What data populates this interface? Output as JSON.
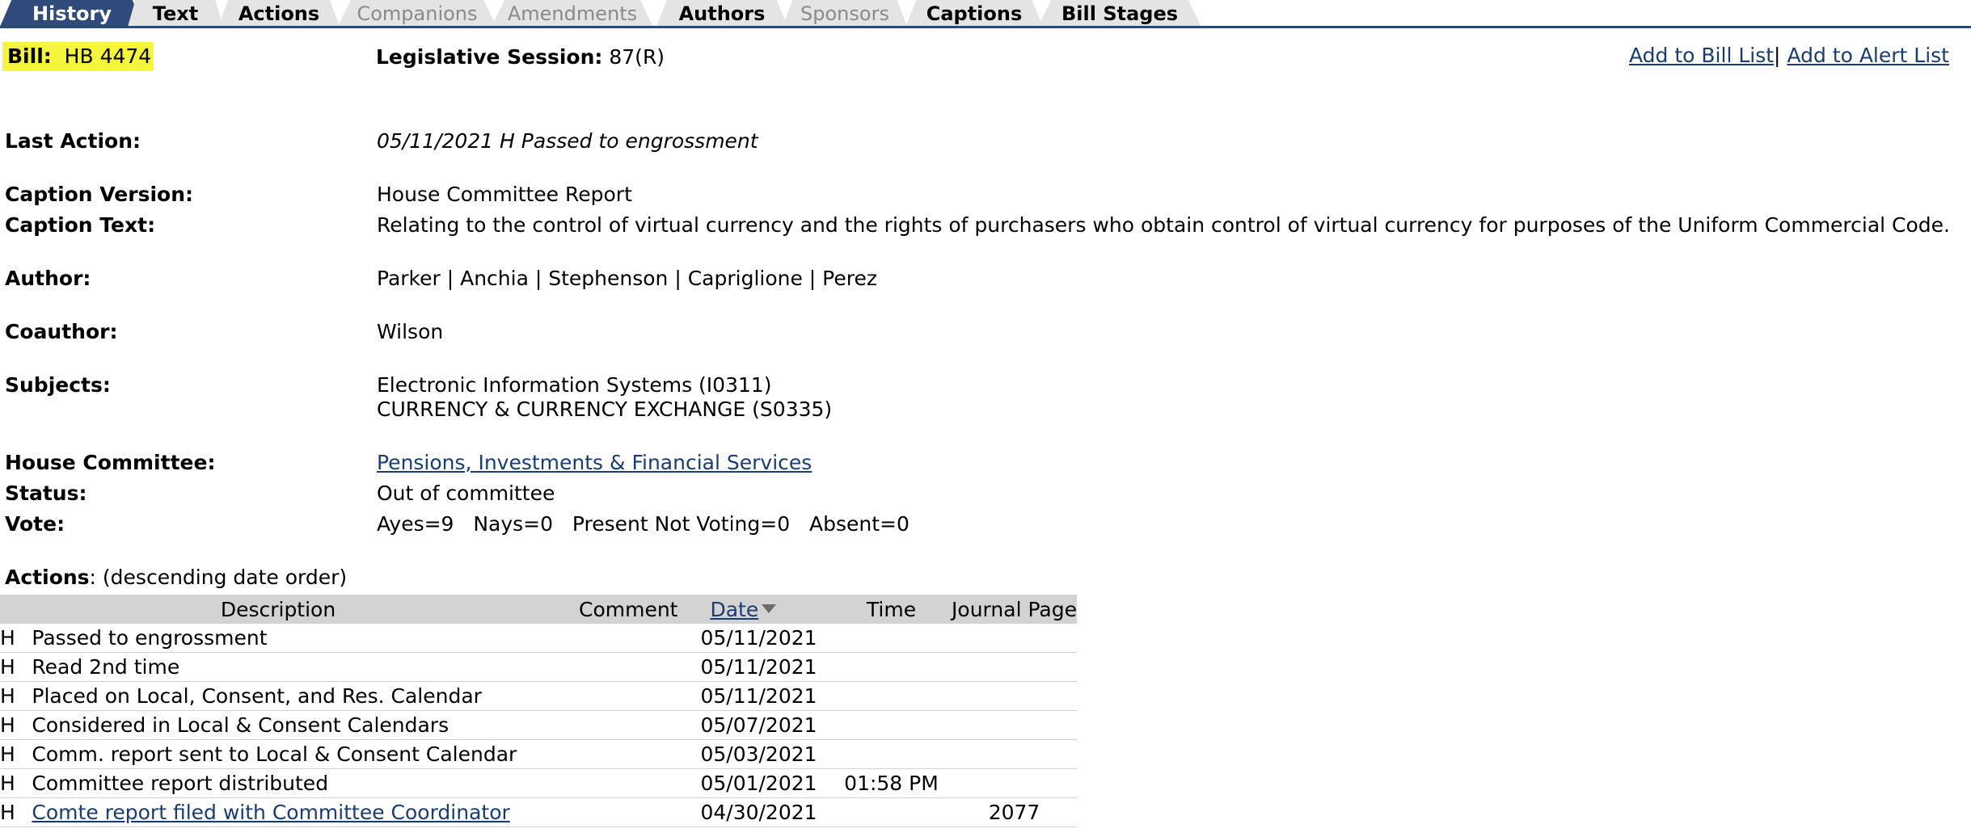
{
  "tabs": [
    {
      "label": "History",
      "state": "active"
    },
    {
      "label": "Text",
      "state": "on"
    },
    {
      "label": "Actions",
      "state": "on"
    },
    {
      "label": "Companions",
      "state": "off"
    },
    {
      "label": "Amendments",
      "state": "off"
    },
    {
      "label": "Authors",
      "state": "on"
    },
    {
      "label": "Sponsors",
      "state": "off"
    },
    {
      "label": "Captions",
      "state": "on"
    },
    {
      "label": "Bill Stages",
      "state": "on"
    }
  ],
  "bill": {
    "label": "Bill:",
    "value": "HB 4474"
  },
  "session": {
    "label": "Legislative Session:",
    "value": "87(R)"
  },
  "links": {
    "add_bill_list": "Add to Bill List",
    "separator": "|",
    "add_alert_list": "Add to Alert List"
  },
  "info": {
    "last_action": {
      "label": "Last Action:",
      "value": "05/11/2021 H Passed to engrossment"
    },
    "caption_version": {
      "label": "Caption Version:",
      "value": "House Committee Report"
    },
    "caption_text": {
      "label": "Caption Text:",
      "value": "Relating to the control of virtual currency and the rights of purchasers who obtain control of virtual currency for purposes of the Uniform Commercial Code."
    },
    "author": {
      "label": "Author:",
      "value": "Parker | Anchia | Stephenson | Capriglione | Perez"
    },
    "coauthor": {
      "label": "Coauthor:",
      "value": "Wilson"
    },
    "subjects": {
      "label": "Subjects:",
      "values": [
        "Electronic Information Systems (I0311)",
        "CURRENCY & CURRENCY EXCHANGE (S0335)"
      ]
    },
    "house_committee": {
      "label": "House Committee:",
      "value": "Pensions, Investments & Financial Services"
    },
    "status": {
      "label": "Status:",
      "value": "Out of committee"
    },
    "vote": {
      "label": "Vote:",
      "ayes": "Ayes=9",
      "nays": "Nays=0",
      "present_not_voting": "Present Not Voting=0",
      "absent": "Absent=0"
    }
  },
  "actions": {
    "title": "Actions",
    "subtitle": ": (descending date order)",
    "columns": {
      "description": "Description",
      "comment": "Comment",
      "date": "Date",
      "time": "Time",
      "journal_page": "Journal Page"
    },
    "rows": [
      {
        "chamber": "H",
        "description": "Passed to engrossment",
        "link": false,
        "comment": "",
        "date": "05/11/2021",
        "time": "",
        "journal_page": ""
      },
      {
        "chamber": "H",
        "description": "Read 2nd time",
        "link": false,
        "comment": "",
        "date": "05/11/2021",
        "time": "",
        "journal_page": ""
      },
      {
        "chamber": "H",
        "description": "Placed on Local, Consent, and Res. Calendar",
        "link": false,
        "comment": "",
        "date": "05/11/2021",
        "time": "",
        "journal_page": ""
      },
      {
        "chamber": "H",
        "description": "Considered in Local & Consent Calendars",
        "link": false,
        "comment": "",
        "date": "05/07/2021",
        "time": "",
        "journal_page": ""
      },
      {
        "chamber": "H",
        "description": "Comm. report sent to Local & Consent Calendar",
        "link": false,
        "comment": "",
        "date": "05/03/2021",
        "time": "",
        "journal_page": ""
      },
      {
        "chamber": "H",
        "description": "Committee report distributed",
        "link": false,
        "comment": "",
        "date": "05/01/2021",
        "time": "01:58 PM",
        "journal_page": ""
      },
      {
        "chamber": "H",
        "description": "Comte report filed with Committee Coordinator",
        "link": true,
        "comment": "",
        "date": "04/30/2021",
        "time": "",
        "journal_page": "2077"
      }
    ]
  },
  "colors": {
    "tab_active": "#2f4b7c",
    "tab_inactive": "#e4e4e4",
    "bill_highlight": "#f5f53c",
    "link": "#1a3c70",
    "table_header": "#d3d3d3"
  }
}
